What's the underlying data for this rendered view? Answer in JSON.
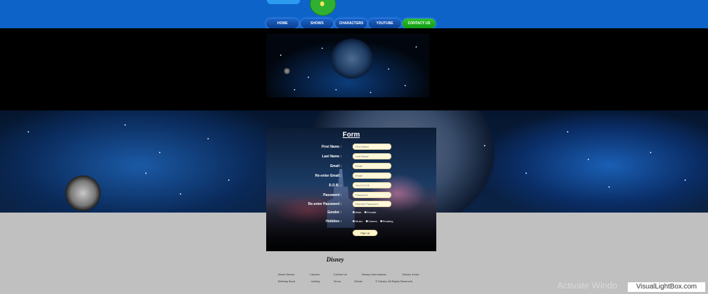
{
  "nav": {
    "items": [
      {
        "label": "HOME"
      },
      {
        "label": "SHOWS"
      },
      {
        "label": "CHARACTERS"
      },
      {
        "label": "YOUTUBE"
      },
      {
        "label": "CONTACT US",
        "active": true
      }
    ]
  },
  "form": {
    "title": "Form",
    "fields": [
      {
        "label": "First Name :",
        "placeholder": "First Name"
      },
      {
        "label": "Last Name :",
        "placeholder": "Last Name"
      },
      {
        "label": "Email :",
        "placeholder": "Email"
      },
      {
        "label": "Re-enter Email :",
        "placeholder": "Email"
      },
      {
        "label": "D.O.B. :",
        "placeholder": "Your D.O.B."
      },
      {
        "label": "Password :",
        "placeholder": "Password"
      },
      {
        "label": "Re-enter Password :",
        "placeholder": "Reenter Password"
      }
    ],
    "gender": {
      "label": "Gender :",
      "options": [
        "Male",
        "Female"
      ]
    },
    "hobbies": {
      "label": "Hobbies :",
      "options": [
        "Music",
        "Games",
        "Reading"
      ]
    },
    "signup_label": "Sign up"
  },
  "footer": {
    "logo_text": "Disney",
    "row1": [
      "About Disney",
      "Careers",
      "Contact Us",
      "Disney International",
      "Disney Junior"
    ],
    "row2": [
      "Birthday Book",
      "Activity",
      "Terms",
      "Global",
      "© Disney. All Rights Reserved."
    ]
  },
  "overlay": {
    "activate_text": "Activate Windo",
    "watermark": "VisualLightBox.com"
  },
  "colors": {
    "header_blue": "#0e63c9",
    "nav_active_green": "#2ec22e",
    "page_gray": "#c0c0c0"
  }
}
